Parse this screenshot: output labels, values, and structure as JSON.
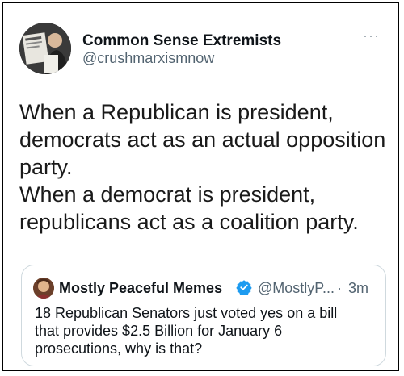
{
  "author": {
    "display_name": "Common Sense Extremists",
    "handle": "@crushmarxismnow"
  },
  "more_icon": "more-horizontal-icon",
  "tweet": {
    "text": "When a Republican is president,\ndemocrats act as an actual opposition\nparty.\nWhen a democrat is president,\nrepublicans act as a coalition party."
  },
  "quoted_tweet": {
    "display_name": "Mostly Peaceful Memes",
    "verified_icon": "verified-badge-icon",
    "handle": "@MostlyP...",
    "separator": "·",
    "time": "3m",
    "text": "18 Republican Senators just voted yes on a bill\nthat provides $2.5 Billion for January 6\nprosecutions, why is that?"
  },
  "colors": {
    "secondary_text": "#536471",
    "verified": "#1d9bf0",
    "border": "#cfd9de"
  }
}
